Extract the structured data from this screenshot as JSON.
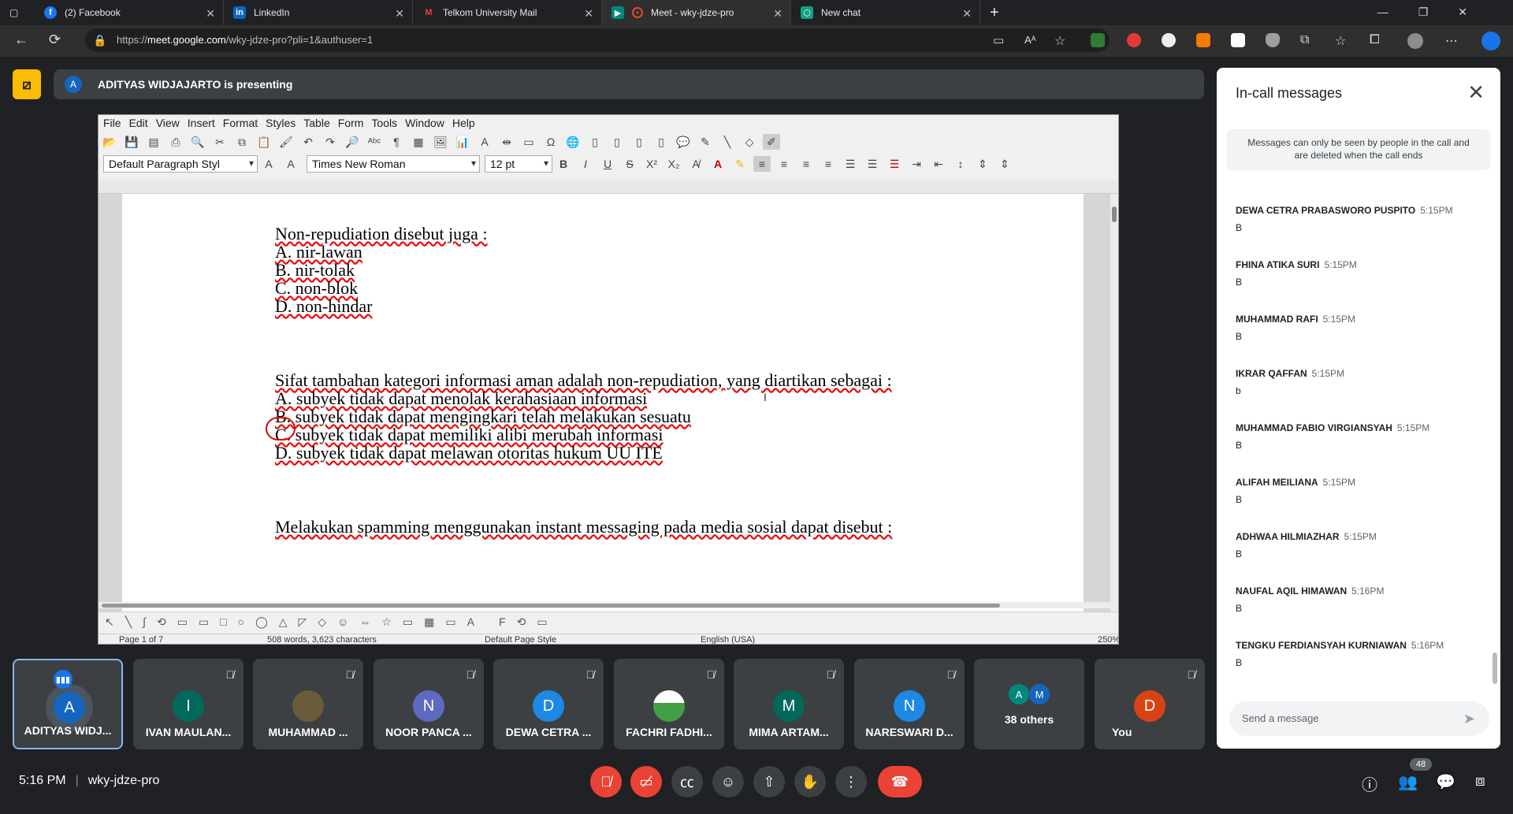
{
  "browser": {
    "tabs": [
      {
        "label": "(2) Facebook",
        "icon": "facebook-icon",
        "color": "#1877f2",
        "glyph": "f"
      },
      {
        "label": "LinkedIn",
        "icon": "linkedin-icon",
        "color": "#0a66c2",
        "glyph": "in"
      },
      {
        "label": "Telkom University Mail",
        "icon": "gmail-icon",
        "color": "#ea4335",
        "glyph": "M"
      },
      {
        "label": "Meet - wky-jdze-pro",
        "icon": "meet-icon",
        "color": "#00897b",
        "glyph": "●"
      },
      {
        "label": "New chat",
        "icon": "chat-icon",
        "color": "#10a37f",
        "glyph": "⬡"
      }
    ],
    "url_prefix": "https://",
    "url_host": "meet.google.com",
    "url_path": "/wky-jdze-pro?pli=1&authuser=1"
  },
  "meet": {
    "banner_initial": "A",
    "banner_text": "ADITYAS WIDJAJARTO is presenting",
    "meeting_code": "wky-jdze-pro",
    "time": "5:16 PM",
    "participant_count": "48",
    "accent": "#1a73e8",
    "danger": "#ea4335"
  },
  "writer": {
    "menu": [
      "File",
      "Edit",
      "View",
      "Insert",
      "Format",
      "Styles",
      "Table",
      "Form",
      "Tools",
      "Window",
      "Help"
    ],
    "paragraph_style": "Default Paragraph Styl",
    "font_name": "Times New Roman",
    "font_size": "12 pt",
    "lines": [
      "Non-repudiation disebut juga :",
      "A. nir-lawan",
      "B. nir-tolak",
      "C. non-blok",
      "D. non-hindar",
      "Sifat tambahan kategori informasi aman adalah non-repudiation, yang diartikan sebagai :",
      "A. subyek tidak dapat menolak kerahasiaan informasi",
      "B. subyek tidak dapat mengingkari telah melakukan sesuatu",
      "C. subyek tidak dapat memiliki alibi merubah informasi",
      "D. subyek tidak dapat melawan otoritas hukum UU ITE",
      "Melakukan spamming menggunakan instant messaging pada media sosial dapat disebut :"
    ],
    "status": {
      "page": "Page 1 of 7",
      "words": "508 words, 3,623 characters",
      "page_style": "Default Page Style",
      "language": "English (USA)",
      "zoom": "250%"
    }
  },
  "chat": {
    "title": "In-call messages",
    "note": "Messages can only be seen by people in the call and are deleted when the call ends",
    "messages": [
      {
        "sender": "DEWA CETRA PRABASWORO PUSPITO",
        "time": "5:15PM",
        "text": "B"
      },
      {
        "sender": "FHINA ATIKA SURI",
        "time": "5:15PM",
        "text": "B"
      },
      {
        "sender": "MUHAMMAD RAFI",
        "time": "5:15PM",
        "text": "B"
      },
      {
        "sender": "IKRAR QAFFAN",
        "time": "5:15PM",
        "text": "b"
      },
      {
        "sender": "MUHAMMAD FABIO VIRGIANSYAH",
        "time": "5:15PM",
        "text": "B"
      },
      {
        "sender": "ALIFAH MEILIANA",
        "time": "5:15PM",
        "text": "B"
      },
      {
        "sender": "ADHWAA HILMIAZHAR",
        "time": "5:15PM",
        "text": "B"
      },
      {
        "sender": "NAUFAL AQIL HIMAWAN",
        "time": "5:16PM",
        "text": "B"
      },
      {
        "sender": "TENGKU FERDIANSYAH KURNIAWAN",
        "time": "5:16PM",
        "text": "B"
      }
    ],
    "send_placeholder": "Send a message"
  },
  "participants": [
    {
      "name": "ADITYAS WIDJ...",
      "initial": "A",
      "color": "#1565c0",
      "speaking": true
    },
    {
      "name": "IVAN MAULAN...",
      "initial": "I",
      "color": "#00695c"
    },
    {
      "name": "MUHAMMAD ...",
      "initial": "",
      "color": "#6b5b3a"
    },
    {
      "name": "NOOR PANCA ...",
      "initial": "N",
      "color": "#5c6bc0"
    },
    {
      "name": "DEWA CETRA ...",
      "initial": "D",
      "color": "#1e88e5"
    },
    {
      "name": "FACHRI FADHI...",
      "initial": "",
      "color": "#43a047"
    },
    {
      "name": "MIMA ARTAM...",
      "initial": "M",
      "color": "#00695c"
    },
    {
      "name": "NARESWARI D...",
      "initial": "N",
      "color": "#1e88e5"
    },
    {
      "name": "38 others",
      "initial": "",
      "color": "#3c4043"
    },
    {
      "name": "You",
      "initial": "D",
      "color": "#d84315"
    }
  ],
  "others_initials": [
    "A",
    "M"
  ]
}
